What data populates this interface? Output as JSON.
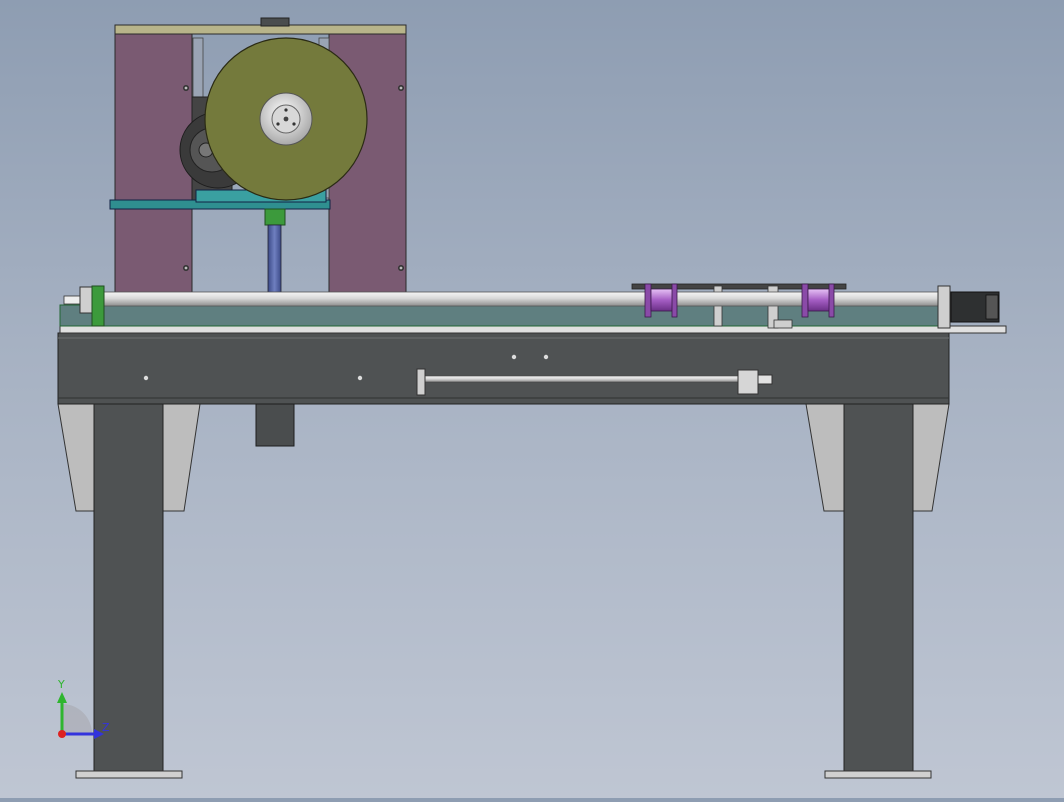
{
  "viewport": {
    "background_top": "#8e9db2",
    "background_bottom": "#bfc6d3"
  },
  "colors": {
    "frame_plate": "#7a5a72",
    "reel": "#747a3c",
    "frame_dark": "#4f5253",
    "rail_teal": "#5f7f80",
    "bracket_teal": "#2f8f90",
    "spool_purple": "#b27acb",
    "green_part": "#3c9a3c",
    "blue_rod": "#4a5a9a",
    "leg_grey": "#bdbdbd"
  },
  "triad": {
    "y_label": "Y",
    "z_label": "Z",
    "y_color": "#2fb52f",
    "z_color": "#3333dd",
    "origin_color": "#dd2222"
  }
}
